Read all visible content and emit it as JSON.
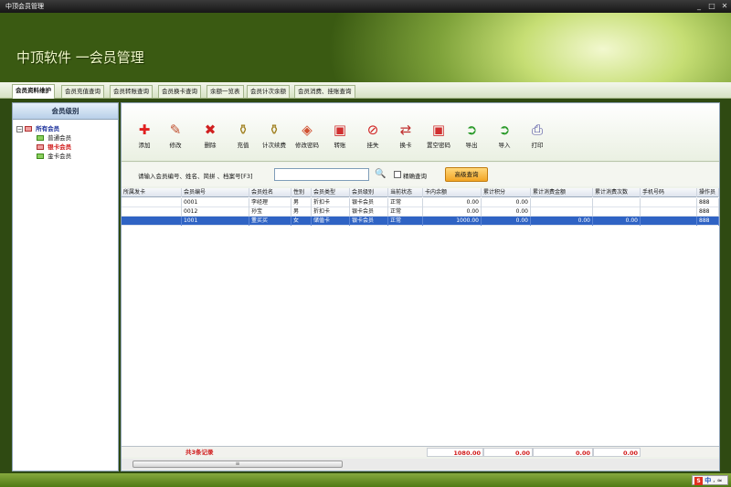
{
  "window": {
    "title": "中顶会员管理",
    "minimize": "_",
    "restore": "□",
    "close": "✕"
  },
  "app": {
    "title": "中顶软件 一会员管理"
  },
  "tabs": [
    {
      "label": "会员资料维护",
      "active": true
    },
    {
      "label": "会员充值查询"
    },
    {
      "label": "会员转账查询"
    },
    {
      "label": "会员换卡查询"
    },
    {
      "label": "余额一览表"
    },
    {
      "label": "会员计次余额"
    },
    {
      "label": "会员消费、挂账查询"
    }
  ],
  "sidebar": {
    "title": "会员级别",
    "root": {
      "label": "所有会员",
      "toggle": "−"
    },
    "items": [
      {
        "label": "普通会员"
      },
      {
        "label": "银卡会员",
        "selected": true
      },
      {
        "label": "金卡会员"
      }
    ]
  },
  "toolbar": {
    "buttons": [
      {
        "label": "添加",
        "icon": "plus-icon",
        "glyph": "✚",
        "color": "#e02020"
      },
      {
        "label": "修改",
        "icon": "pencil-icon",
        "glyph": "✎",
        "color": "#c05030"
      },
      {
        "label": "删除",
        "icon": "cross-icon",
        "glyph": "✖",
        "color": "#d02020"
      },
      {
        "label": "充值",
        "icon": "gold-key-icon",
        "glyph": "⚱",
        "color": "#a08020"
      },
      {
        "label": "计次续费",
        "icon": "gold-key-icon",
        "glyph": "⚱",
        "color": "#a08020"
      },
      {
        "label": "修改密码",
        "icon": "shield-icon",
        "glyph": "◈",
        "color": "#d05030"
      },
      {
        "label": "转账",
        "icon": "card-icon",
        "glyph": "▣",
        "color": "#d03030"
      },
      {
        "label": "挂失",
        "icon": "stop-icon",
        "glyph": "⊘",
        "color": "#d02020"
      },
      {
        "label": "换卡",
        "icon": "swap-icon",
        "glyph": "⇄",
        "color": "#c03030"
      },
      {
        "label": "置空密码",
        "icon": "card-icon",
        "glyph": "▣",
        "color": "#d03030"
      },
      {
        "label": "导出",
        "icon": "export-icon",
        "glyph": "➲",
        "color": "#2a9a2a"
      },
      {
        "label": "导入",
        "icon": "import-icon",
        "glyph": "➲",
        "color": "#2a9a2a"
      },
      {
        "label": "打印",
        "icon": "printer-icon",
        "glyph": "⎙",
        "color": "#5050a0"
      }
    ]
  },
  "search": {
    "label": "请输入会员编号、姓名、简拼 、档案号[F3]",
    "value": "",
    "exact_label": "精确查询",
    "advanced_label": "高级查询"
  },
  "table": {
    "columns": [
      "所属发卡",
      "会员编号",
      "会员姓名",
      "性别",
      "会员类型",
      "会员级别",
      "当前状态",
      "卡内余额",
      "累计积分",
      "累计消费金额",
      "累计消费次数",
      "手机号码",
      "操作员"
    ],
    "rows": [
      [
        "",
        "0001",
        "李经理",
        "男",
        "折扣卡",
        "银卡会员",
        "正常",
        "0.00",
        "0.00",
        "",
        "",
        "",
        "888"
      ],
      [
        "",
        "0012",
        "孙宝",
        "男",
        "折扣卡",
        "银卡会员",
        "正常",
        "0.00",
        "0.00",
        "",
        "",
        "",
        "888"
      ],
      [
        "",
        "1001",
        "董买买",
        "女",
        "储值卡",
        "银卡会员",
        "正常",
        "1000.00",
        "0.00",
        "0.00",
        "0.00",
        "",
        "888"
      ]
    ],
    "selected_row": 2
  },
  "footer": {
    "count": "共3条记录",
    "balance": "1080.00",
    "points": "0.00",
    "spend": "0.00",
    "times": "0.00"
  },
  "scroll": {
    "grip": "≡"
  },
  "ime": {
    "logo": "S",
    "lang": "中",
    "extra": "⸴ ≈"
  }
}
